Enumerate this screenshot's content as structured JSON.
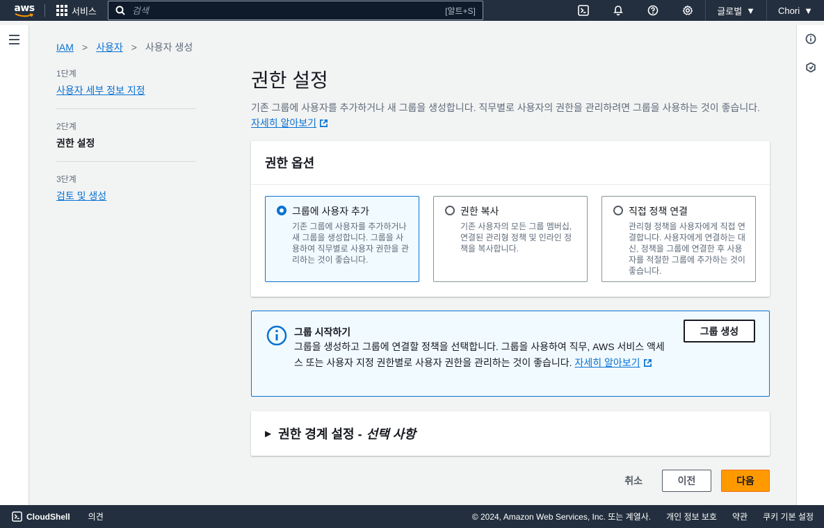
{
  "topnav": {
    "logo_text": "aws",
    "services_label": "서비스",
    "search_placeholder": "검색",
    "search_shortcut": "[알트+S]",
    "region_label": "글로벌",
    "user_label": "Chori",
    "icons": [
      "cloudshell-icon",
      "bell-icon",
      "help-icon",
      "settings-icon"
    ]
  },
  "breadcrumb": {
    "items": [
      "IAM",
      "사용자"
    ],
    "current": "사용자 생성"
  },
  "steps": [
    {
      "num": "1단계",
      "label": "사용자 세부 정보 지정"
    },
    {
      "num": "2단계",
      "label": "권한 설정"
    },
    {
      "num": "3단계",
      "label": "검토 및 생성"
    }
  ],
  "main": {
    "title": "권한 설정",
    "desc": "기존 그룹에 사용자를 추가하거나 새 그룹을 생성합니다. 직무별로 사용자의 권한을 관리하려면 그룹을 사용하는 것이 좋습니다.",
    "learn_more": "자세히 알아보기"
  },
  "permission_options": {
    "heading": "권한 옵션",
    "options": [
      {
        "title": "그룹에 사용자 추가",
        "desc": "기존 그룹에 사용자를 추가하거나 새 그룹을 생성합니다. 그룹을 사용하여 직무별로 사용자 권한을 관리하는 것이 좋습니다.",
        "selected": true
      },
      {
        "title": "권한 복사",
        "desc": "기존 사용자의 모든 그룹 멤버십, 연결된 관리형 정책 및 인라인 정책을 복사합니다.",
        "selected": false
      },
      {
        "title": "직접 정책 연결",
        "desc": "관리형 정책을 사용자에게 직접 연결합니다. 사용자에게 연결하는 대신, 정책을 그룹에 연결한 후 사용자를 적절한 그룹에 추가하는 것이 좋습니다.",
        "selected": false
      }
    ]
  },
  "info_box": {
    "title": "그룹 시작하기",
    "body": "그룹을 생성하고 그룹에 연결할 정책을 선택합니다. 그룹을 사용하여 직무, AWS 서비스 액세스 또는 사용자 지정 권한별로 사용자 권한을 관리하는 것이 좋습니다.",
    "learn_more": "자세히 알아보기",
    "button": "그룹 생성"
  },
  "boundary": {
    "label": "권한 경계 설정 -",
    "optional": "선택 사항"
  },
  "actions": {
    "cancel": "취소",
    "previous": "이전",
    "next": "다음"
  },
  "footer": {
    "cloudshell": "CloudShell",
    "feedback": "의견",
    "copyright": "© 2024, Amazon Web Services, Inc. 또는 계열사.",
    "privacy": "개인 정보 보호",
    "terms": "약관",
    "cookies": "쿠키 기본 설정"
  },
  "colors": {
    "nav_bg": "#232f3e",
    "link": "#0972d3",
    "primary": "#ff9900"
  }
}
